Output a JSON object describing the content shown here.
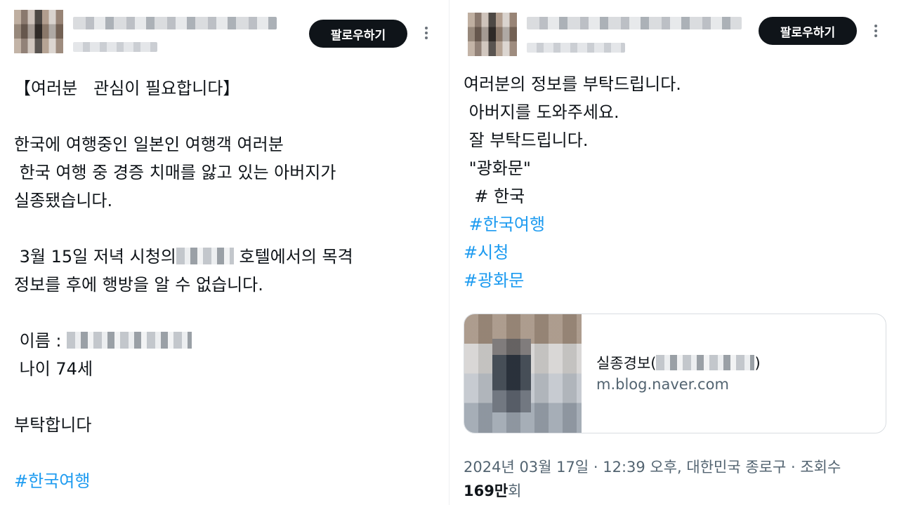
{
  "left_post": {
    "follow_label": "팔로우하기",
    "lines": [
      "【여러분   관심이 필요합니다】",
      "",
      "한국에 여행중인 일본인 여행객 여러분",
      " 한국 여행 중 경증 치매를 앓고 있는 아버지가",
      "실종됐습니다.",
      "",
      " 3월 15일 저녁 시청의",
      "정보를 후에 행방을 알 수 없습니다.",
      "",
      " 이름 :",
      " 나이 74세",
      "",
      "부탁합니다",
      ""
    ],
    "line7_suffix": " 호텔에서의 목격",
    "hashtag": "#한국여행"
  },
  "right_post": {
    "follow_label": "팔로우하기",
    "lines": [
      "여러분의 정보를 부탁드립니다.",
      " 아버지를 도와주세요.",
      " 잘 부탁드립니다.",
      " \"광화문\"",
      "  # 한국"
    ],
    "hashtags": [
      " #한국여행",
      "#시청",
      "#광화문"
    ],
    "link_card": {
      "title_prefix": "실종경보(",
      "title_suffix": ")",
      "domain": "m.blog.naver.com"
    },
    "meta": "2024년 03월 17일 · 12:39 오후, 대한민국 종로구 · 조회수",
    "views_count": "169만",
    "views_suffix": "회"
  }
}
